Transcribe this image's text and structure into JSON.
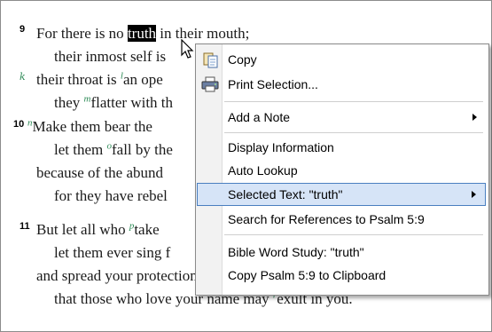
{
  "passage": {
    "v9_num": "9",
    "v9_line1_pre": "For there is no ",
    "v9_line1_sel": "truth",
    "v9_line1_post": " in their mouth;",
    "v9_line2": "their inmost self is",
    "fn_k": "k",
    "v9_line3_pre": "their throat is ",
    "fn_l": "l",
    "v9_line3_post": "an ope",
    "v9_line4_pre": "they ",
    "fn_m": "m",
    "v9_line4_post": "flatter with th",
    "v10_num": "10",
    "fn_n": "n",
    "v10_line1": "Make them bear the",
    "v10_line2_pre": "let them ",
    "fn_o": "o",
    "v10_line2_post": "fall by the",
    "v10_line3": "because of the abund",
    "v10_line4": "for they have rebel",
    "v11_num": "11",
    "v11_line1_pre": "But let all who ",
    "fn_p": "p",
    "v11_line1_post": "take",
    "v11_line2": "let them ever sing f",
    "v11_line3": "and spread your protection over them,",
    "v11_line4_pre": "that those who love your name may ",
    "fn_r": "r",
    "v11_line4_post": "exult in you."
  },
  "menu": {
    "copy": "Copy",
    "print": "Print Selection...",
    "add_note": "Add a Note",
    "display_info": "Display Information",
    "auto_lookup": "Auto Lookup",
    "selected_text": "Selected Text: \"truth\"",
    "search_refs": "Search for References to Psalm 5:9",
    "word_study": "Bible Word Study: \"truth\"",
    "copy_psalm": "Copy Psalm 5:9 to Clipboard"
  },
  "colors": {
    "footnote": "#2e8b57",
    "highlight_bg": "#d6e4f7",
    "highlight_border": "#4a7fc0"
  },
  "icons": [
    "copy-icon",
    "print-icon",
    "submenu-arrow-icon",
    "mouse-cursor-icon"
  ]
}
